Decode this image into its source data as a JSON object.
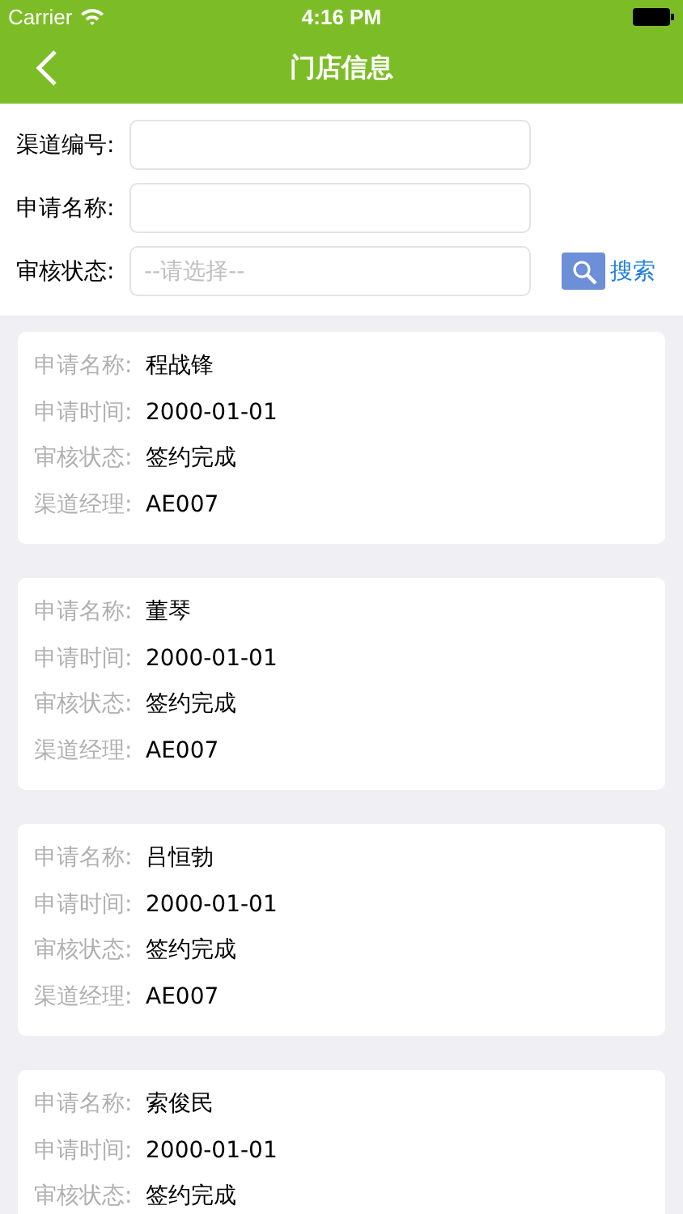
{
  "status_bar": {
    "carrier": "Carrier",
    "time": "4:16 PM"
  },
  "nav": {
    "title": "门店信息"
  },
  "filters": [
    {
      "label": "渠道编号:",
      "kind": "text"
    },
    {
      "label": "申请名称:",
      "kind": "text"
    },
    {
      "label": "审核状态:",
      "kind": "select",
      "placeholder": "--请选择--"
    }
  ],
  "search_button": {
    "label": "搜索"
  },
  "records": [
    {
      "fields": [
        {
          "label": "申请名称:",
          "value": "程战锋"
        },
        {
          "label": "申请时间:",
          "value": "2000-01-01"
        },
        {
          "label": "审核状态:",
          "value": "签约完成"
        },
        {
          "label": "渠道经理:",
          "value": "AE007"
        }
      ]
    },
    {
      "fields": [
        {
          "label": "申请名称:",
          "value": "董琴"
        },
        {
          "label": "申请时间:",
          "value": "2000-01-01"
        },
        {
          "label": "审核状态:",
          "value": "签约完成"
        },
        {
          "label": "渠道经理:",
          "value": "AE007"
        }
      ]
    },
    {
      "fields": [
        {
          "label": "申请名称:",
          "value": "吕恒勃"
        },
        {
          "label": "申请时间:",
          "value": "2000-01-01"
        },
        {
          "label": "审核状态:",
          "value": "签约完成"
        },
        {
          "label": "渠道经理:",
          "value": "AE007"
        }
      ]
    },
    {
      "fields": [
        {
          "label": "申请名称:",
          "value": "索俊民"
        },
        {
          "label": "申请时间:",
          "value": "2000-01-01"
        },
        {
          "label": "审核状态:",
          "value": "签约完成"
        }
      ]
    }
  ]
}
